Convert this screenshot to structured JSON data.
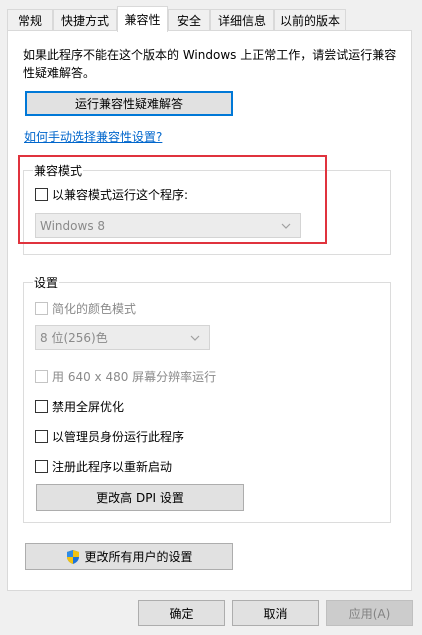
{
  "tabs": [
    {
      "label": "常规"
    },
    {
      "label": "快捷方式"
    },
    {
      "label": "兼容性"
    },
    {
      "label": "安全"
    },
    {
      "label": "详细信息"
    },
    {
      "label": "以前的版本"
    }
  ],
  "compat": {
    "description": "如果此程序不能在这个版本的 Windows 上正常工作，请尝试运行兼容性疑难解答。",
    "troubleshooter_button": "运行兼容性疑难解答",
    "manual_link": "如何手动选择兼容性设置?",
    "mode_group_title": "兼容模式",
    "mode_checkbox_label": "以兼容模式运行这个程序:",
    "mode_select_value": "Windows 8"
  },
  "settings": {
    "group_title": "设置",
    "reduced_color_label": "简化的颜色模式",
    "color_select_value": "8 位(256)色",
    "res_640_label": "用 640 x 480 屏幕分辨率运行",
    "disable_fullscreen_label": "禁用全屏优化",
    "run_as_admin_label": "以管理员身份运行此程序",
    "register_restart_label": "注册此程序以重新启动",
    "dpi_button": "更改高 DPI 设置"
  },
  "all_users_button": "更改所有用户的设置",
  "footer": {
    "ok": "确定",
    "cancel": "取消",
    "apply": "应用(A)"
  },
  "colors": {
    "highlight_box": "#e0333d",
    "link": "#0066cc",
    "focus": "#0078d7"
  }
}
